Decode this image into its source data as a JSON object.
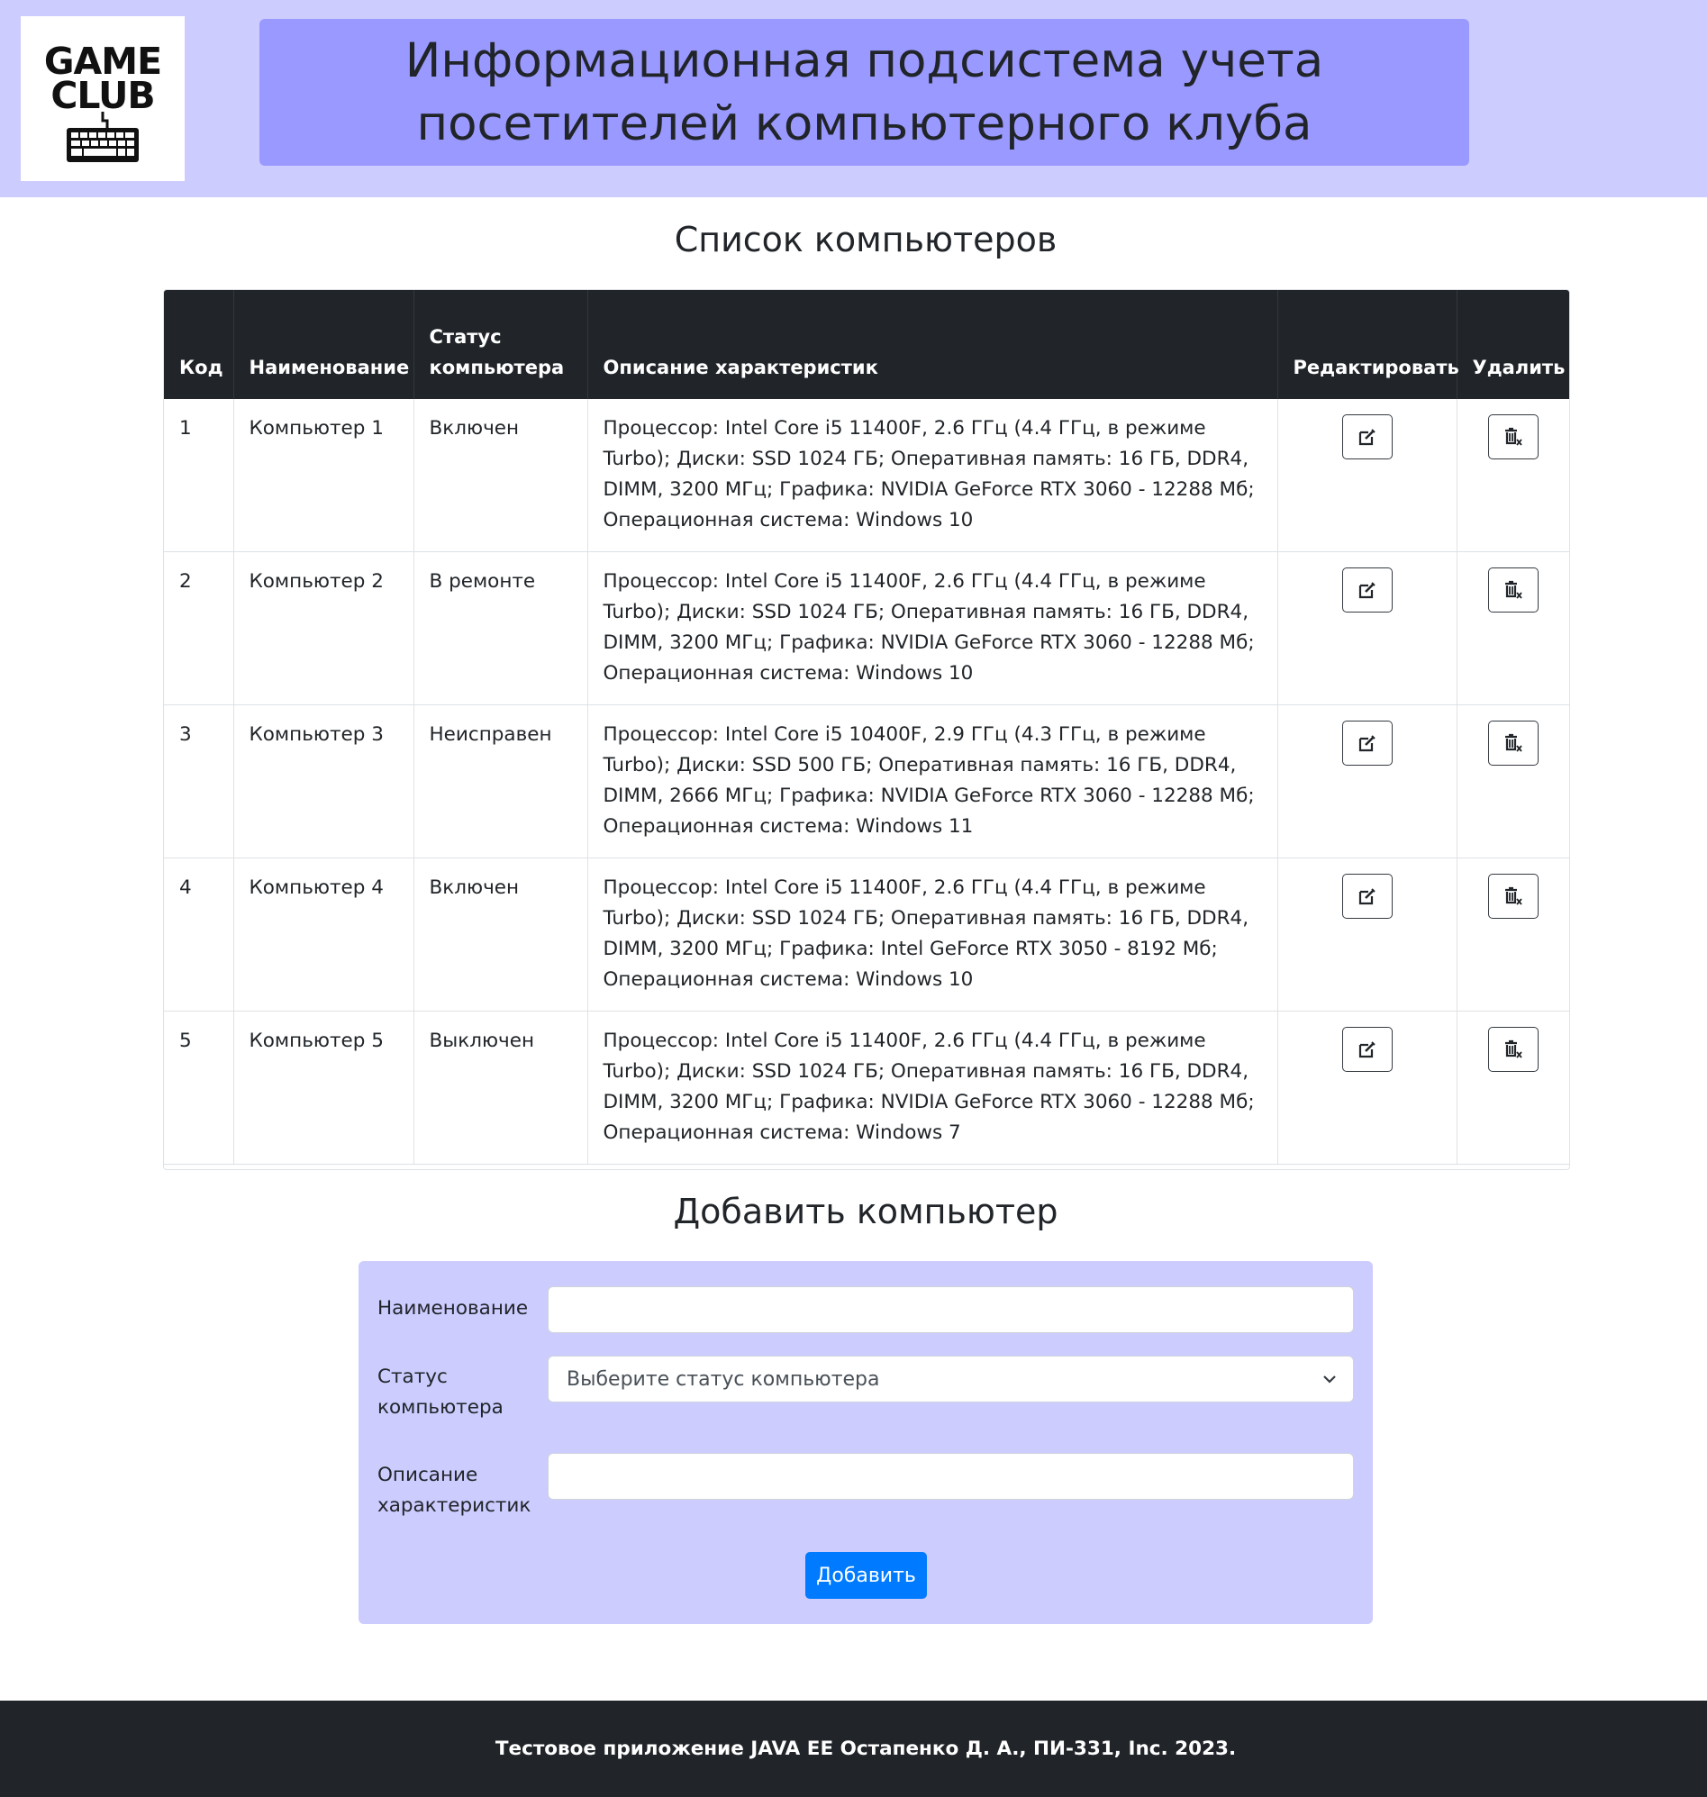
{
  "header": {
    "logo": {
      "line1": "GAME",
      "line2": "CLUB",
      "icon": "keyboard-icon"
    },
    "title": "Информационная подсистема учета посетителей компьютерного клуба"
  },
  "computers_section": {
    "title": "Список компьютеров",
    "columns": {
      "code": "Код",
      "name": "Наименование",
      "status": "Статус компьютера",
      "description": "Описание характеристик",
      "edit": "Редактировать",
      "delete": "Удалить"
    },
    "rows": [
      {
        "code": "1",
        "name": "Компьютер 1",
        "status": "Включен",
        "description": "Процессор: Intel Core i5 11400F, 2.6 ГГц (4.4 ГГц, в режиме Turbo); Диски: SSD 1024 ГБ; Оперативная память: 16 ГБ, DDR4, DIMM, 3200 МГц; Графика: NVIDIA GeForce RTX 3060 - 12288 Мб; Операционная система: Windows 10"
      },
      {
        "code": "2",
        "name": "Компьютер 2",
        "status": "В ремонте",
        "description": "Процессор: Intel Core i5 11400F, 2.6 ГГц (4.4 ГГц, в режиме Turbo); Диски: SSD 1024 ГБ; Оперативная память: 16 ГБ, DDR4, DIMM, 3200 МГц; Графика: NVIDIA GeForce RTX 3060 - 12288 Мб; Операционная система: Windows 10"
      },
      {
        "code": "3",
        "name": "Компьютер 3",
        "status": "Неисправен",
        "description": "Процессор: Intel Core i5 10400F, 2.9 ГГц (4.3 ГГц, в режиме Turbo); Диски: SSD 500 ГБ; Оперативная память: 16 ГБ, DDR4, DIMM, 2666 МГц; Графика: NVIDIA GeForce RTX 3060 - 12288 Мб; Операционная система: Windows 11"
      },
      {
        "code": "4",
        "name": "Компьютер 4",
        "status": "Включен",
        "description": "Процессор: Intel Core i5 11400F, 2.6 ГГц (4.4 ГГц, в режиме Turbo); Диски: SSD 1024 ГБ; Оперативная память: 16 ГБ, DDR4, DIMM, 3200 МГц; Графика: Intel GeForce RTX 3050 - 8192 Мб; Операционная система: Windows 10"
      },
      {
        "code": "5",
        "name": "Компьютер 5",
        "status": "Выключен",
        "description": "Процессор: Intel Core i5 11400F, 2.6 ГГц (4.4 ГГц, в режиме Turbo); Диски: SSD 1024 ГБ; Оперативная память: 16 ГБ, DDR4, DIMM, 3200 МГц; Графика: NVIDIA GeForce RTX 3060 - 12288 Мб; Операционная система: Windows 7"
      }
    ],
    "icons": {
      "edit": "edit-icon",
      "delete": "trash-icon"
    }
  },
  "add_section": {
    "title": "Добавить компьютер",
    "fields": {
      "name_label": "Наименование",
      "name_value": "",
      "status_label": "Статус компьютера",
      "status_selected": "Выберите статус компьютера",
      "description_label": "Описание характеристик",
      "description_value": ""
    },
    "submit_label": "Добавить"
  },
  "footer": {
    "text": "Тестовое приложение JAVA EE Остапенко Д. А., ПИ-331, Inc. 2023."
  },
  "colors": {
    "header_bg": "#ccccff",
    "title_bg": "#9999ff",
    "table_head_bg": "#212529",
    "form_bg": "#ccccff",
    "primary_button": "#007bff",
    "footer_bg": "#212529"
  }
}
